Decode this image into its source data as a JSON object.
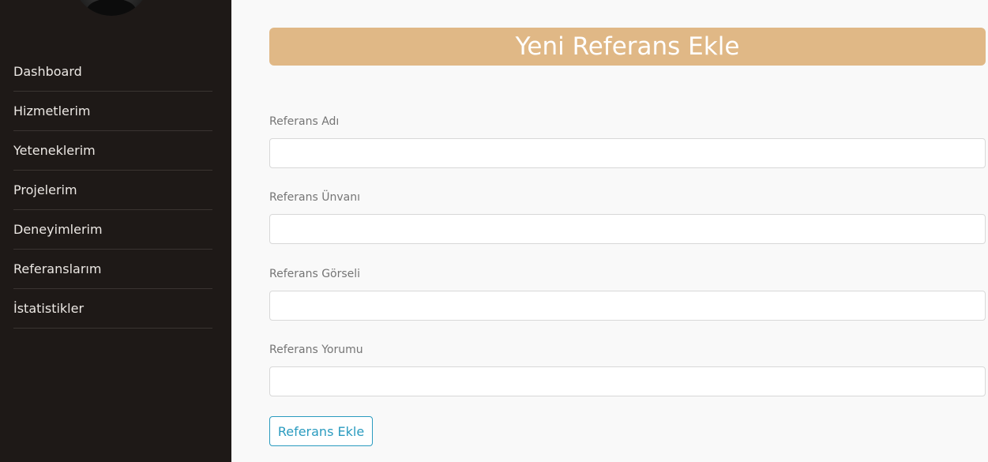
{
  "sidebar": {
    "items": [
      {
        "label": "Dashboard"
      },
      {
        "label": "Hizmetlerim"
      },
      {
        "label": "Yeteneklerim"
      },
      {
        "label": "Projelerim"
      },
      {
        "label": "Deneyimlerim"
      },
      {
        "label": "Referanslarım"
      },
      {
        "label": "İstatistikler"
      }
    ]
  },
  "main": {
    "title": "Yeni Referans Ekle",
    "fields": [
      {
        "label": "Referans Adı",
        "value": ""
      },
      {
        "label": "Referans Ünvanı",
        "value": ""
      },
      {
        "label": "Referans Görseli",
        "value": ""
      },
      {
        "label": "Referans Yorumu",
        "value": ""
      }
    ],
    "submit_label": "Referans Ekle"
  },
  "colors": {
    "sidebar_bg": "#1e1917",
    "title_bar": "#e0b886",
    "accent": "#2a9bbf",
    "page_bg": "#f9f9f9"
  }
}
